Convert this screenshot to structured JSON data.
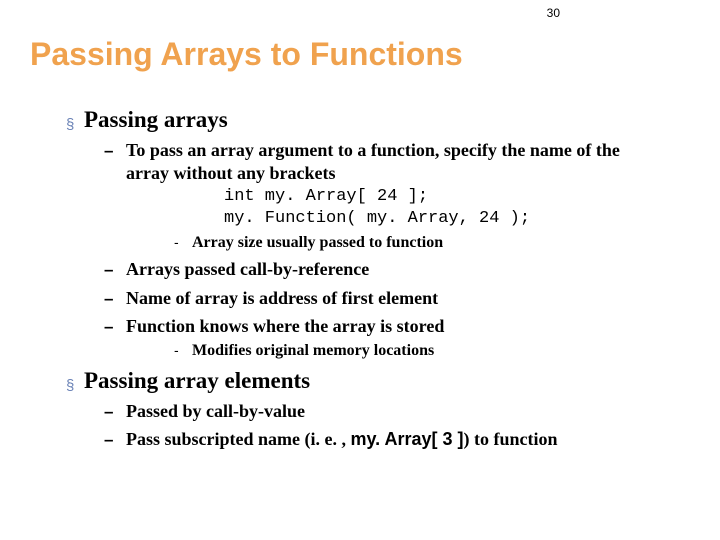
{
  "page_number": "30",
  "title": "Passing Arrays to Functions",
  "section1": {
    "heading": "Passing arrays",
    "item1_text": "To pass an array argument to a function, specify the name of the array without any brackets",
    "code_line1": "int my. Array[ 24 ];",
    "code_line2": "my. Function( my. Array, 24 );",
    "sub1": "Array size usually passed to function",
    "item2": "Arrays passed call-by-reference",
    "item3": "Name of array is address of first element",
    "item4": "Function knows where the array is stored",
    "sub2": "Modifies original memory locations"
  },
  "section2": {
    "heading": "Passing array elements",
    "item1": "Passed by call-by-value",
    "item2_prefix": "Pass subscripted name (i. e. , ",
    "item2_code": "my. Array[ 3 ]",
    "item2_suffix": ") to function"
  }
}
